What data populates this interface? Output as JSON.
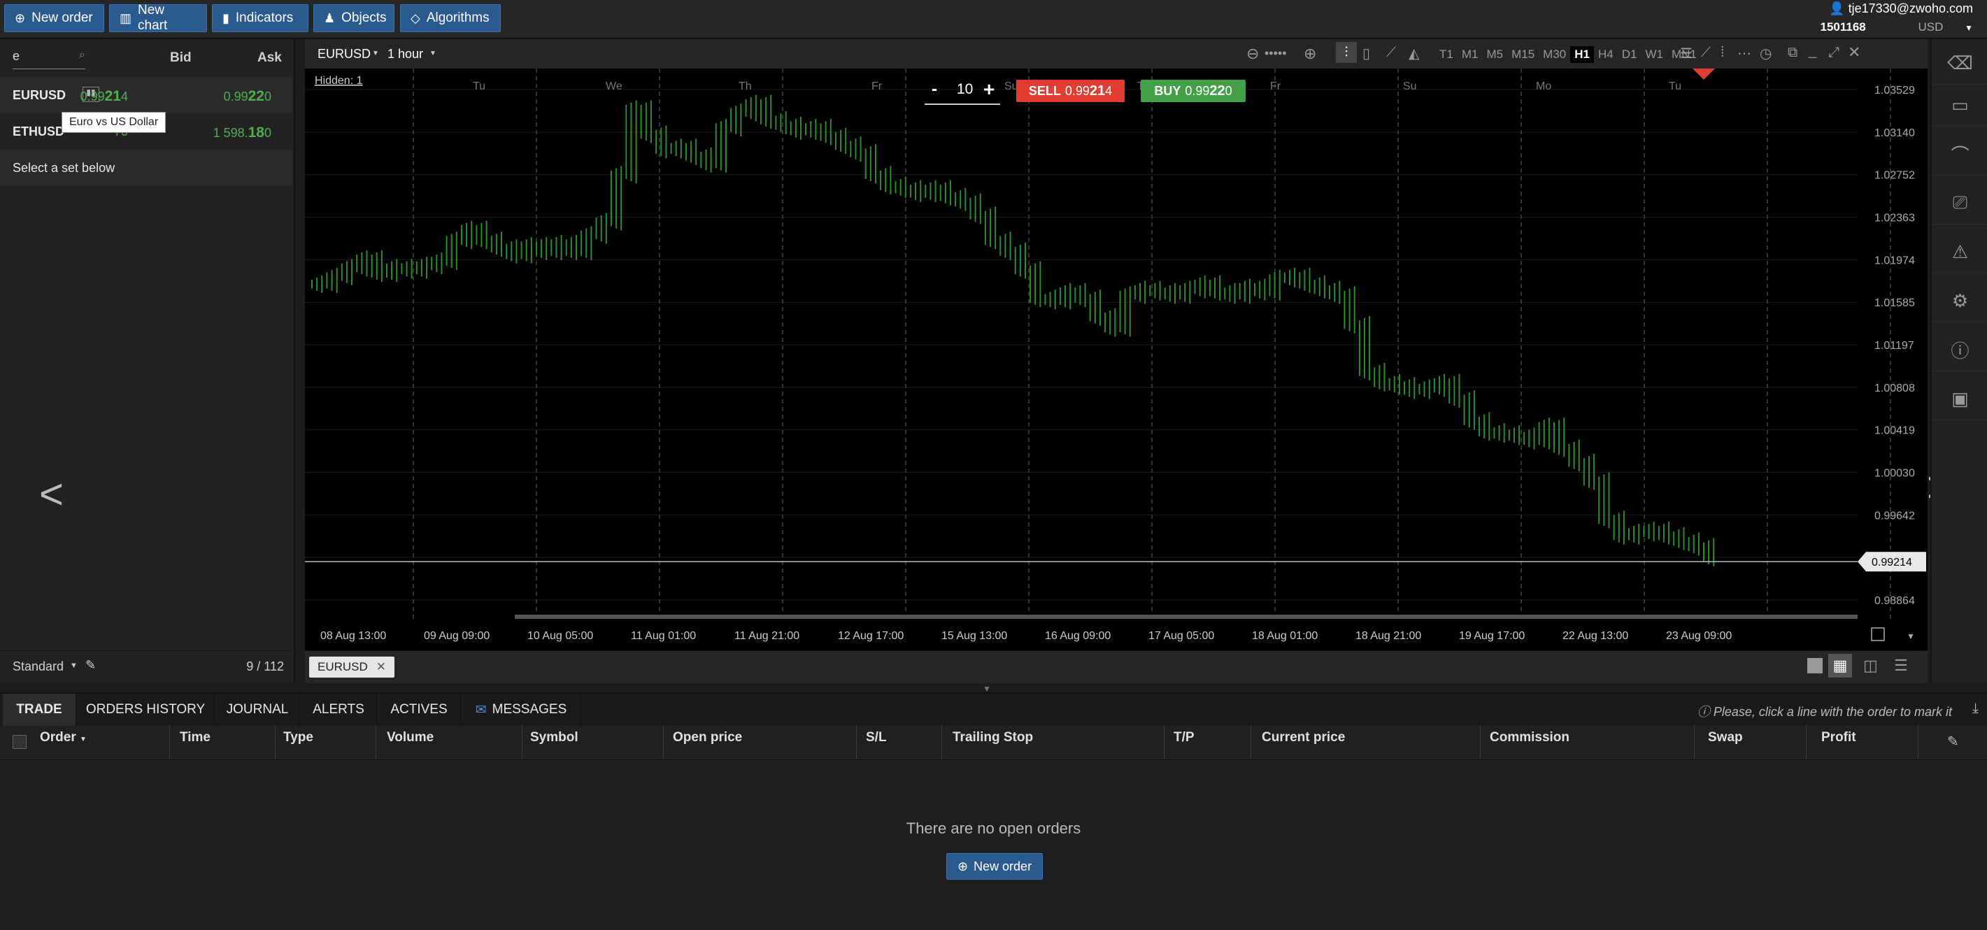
{
  "toolbar": {
    "new_order": "New order",
    "new_chart": "New chart",
    "indicators": "Indicators",
    "objects": "Objects",
    "algorithms": "Algorithms"
  },
  "account": {
    "email": "tje17330@zwoho.com",
    "number": "1501168",
    "currency": "USD"
  },
  "watchlist": {
    "search_value": "e",
    "col_bid": "Bid",
    "col_ask": "Ask",
    "rows": [
      {
        "symbol": "EURUSD",
        "bid_pre": "0.99",
        "bid_big": "21",
        "bid_post": "4",
        "ask_pre": "0.99",
        "ask_big": "22",
        "ask_post": "0"
      },
      {
        "symbol": "ETHUSD",
        "bid_pre": "",
        "bid_big": "",
        "bid_post": "70",
        "ask_pre": "1 598.",
        "ask_big": "18",
        "ask_post": "0"
      }
    ],
    "tooltip": "Euro vs US Dollar",
    "select_set": "Select a set below",
    "set_name": "Standard",
    "count": "9 / 112"
  },
  "chart": {
    "symbol": "EURUSD",
    "timeframe": "1 hour",
    "hidden_label": "Hidden: 1",
    "lot_minus": "-",
    "lot_value": "10",
    "lot_plus": "+",
    "sell_label": "SELL",
    "sell_pre": "0.99",
    "sell_big": "21",
    "sell_post": "4",
    "buy_label": "BUY",
    "buy_pre": "0.99",
    "buy_big": "22",
    "buy_post": "0",
    "timeframes": [
      "T1",
      "M1",
      "M5",
      "M15",
      "M30",
      "H1",
      "H4",
      "D1",
      "W1",
      "MN1"
    ],
    "active_timeframe": "H1",
    "day_labels": [
      "Tu",
      "We",
      "Th",
      "Fr",
      "Su",
      "Th",
      "Fr",
      "Su",
      "Mo",
      "Tu"
    ],
    "tab_label": "EURUSD",
    "current_price_label": "0.99214"
  },
  "chart_data": {
    "type": "bar",
    "title": "",
    "x_tick_labels": [
      "08 Aug 13:00",
      "09 Aug 09:00",
      "10 Aug 05:00",
      "11 Aug 01:00",
      "11 Aug 21:00",
      "12 Aug 17:00",
      "15 Aug 13:00",
      "16 Aug 09:00",
      "17 Aug 05:00",
      "18 Aug 01:00",
      "18 Aug 21:00",
      "19 Aug 17:00",
      "22 Aug 13:00",
      "23 Aug 09:00"
    ],
    "y_tick_labels": [
      "1.03529",
      "1.03140",
      "1.02752",
      "1.02363",
      "1.01974",
      "1.01585",
      "1.01197",
      "1.00808",
      "1.00419",
      "1.00030",
      "0.99642",
      "0.99253",
      "0.98864"
    ],
    "ylim": [
      0.98864,
      1.03529
    ],
    "grid": true,
    "current_price": 0.99214,
    "series": [
      {
        "values": [
          1.0175,
          1.0182,
          1.019,
          1.0198,
          1.0185,
          1.019,
          1.0188,
          1.0192,
          1.0196,
          1.0215,
          1.0225,
          1.0215,
          1.0208,
          1.0202,
          1.021,
          1.0205,
          1.0212,
          1.0205,
          1.022,
          1.0232,
          1.0275,
          1.0335,
          1.0312,
          1.0298,
          1.03,
          1.0292,
          1.0285,
          1.0318,
          1.0332,
          1.034,
          1.0325,
          1.032,
          1.0315,
          1.0318,
          1.031,
          1.0302,
          1.0295,
          1.0275,
          1.0265,
          1.0262,
          1.0258,
          1.0262,
          1.0255,
          1.025,
          1.0238,
          1.0215,
          1.0205,
          1.0188,
          1.0162,
          1.016,
          1.0168,
          1.0162,
          1.0145,
          1.0135,
          1.0165,
          1.017,
          1.0168,
          1.0165,
          1.017,
          1.0175,
          1.0168,
          1.0165,
          1.0172,
          1.0168,
          1.018,
          1.0182,
          1.0175,
          1.017,
          1.0165,
          1.0138,
          1.0095,
          1.0085,
          1.0082,
          1.0078,
          1.008,
          1.0085,
          1.007,
          1.005,
          1.004,
          1.0038,
          1.0036,
          1.0032,
          1.0045,
          1.0025,
          1.0012,
          0.9995,
          0.996,
          0.9945,
          0.9948,
          0.995,
          0.9945,
          0.994,
          0.9935,
          0.9925
        ]
      }
    ]
  },
  "bottom": {
    "tabs": [
      "TRADE",
      "ORDERS HISTORY",
      "JOURNAL",
      "ALERTS",
      "ACTIVES",
      "MESSAGES"
    ],
    "hint": "Please, click a line with the order to mark it",
    "columns": [
      "Order",
      "Time",
      "Type",
      "Volume",
      "Symbol",
      "Open price",
      "S/L",
      "Trailing Stop",
      "T/P",
      "Current price",
      "Commission",
      "Swap",
      "Profit"
    ],
    "empty_message": "There are no open orders",
    "new_order": "New order"
  },
  "colors": {
    "accent": "#2b5a8f",
    "sell": "#e03c31",
    "buy": "#43a047",
    "candle": "#2e8b2e"
  }
}
